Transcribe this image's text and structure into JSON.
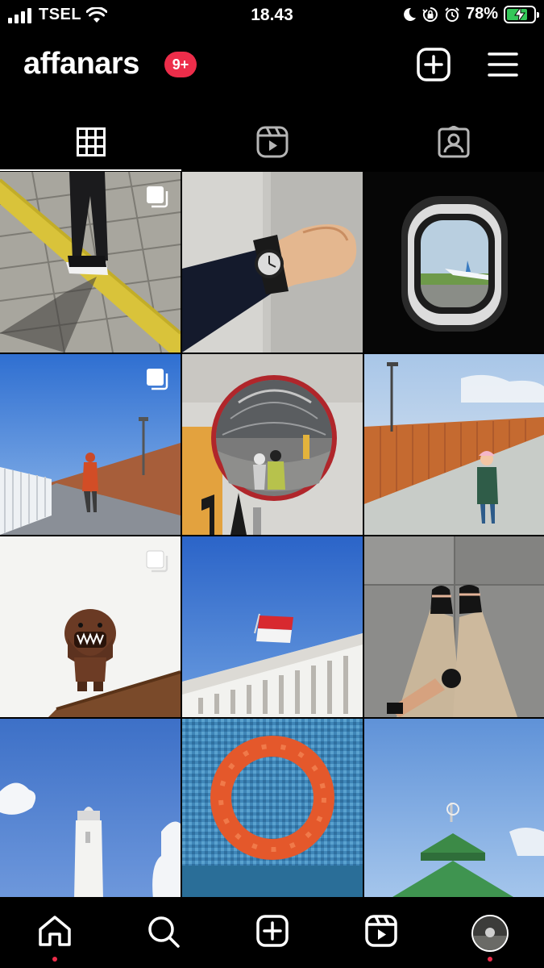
{
  "status_bar": {
    "carrier": "TSEL",
    "time": "18.43",
    "battery_percent": "78%",
    "battery_level": 0.78
  },
  "header": {
    "username": "affanars",
    "notification_count": "9+",
    "icons": [
      "add-post-icon",
      "menu-icon"
    ]
  },
  "profile_tabs": {
    "items": [
      {
        "name": "posts-grid-tab",
        "icon": "grid-icon",
        "active": true
      },
      {
        "name": "reels-tab",
        "icon": "reels-icon",
        "active": false
      },
      {
        "name": "tagged-tab",
        "icon": "tagged-person-icon",
        "active": false
      }
    ]
  },
  "posts": [
    {
      "subject": "feet on tactile paving",
      "multiple": true
    },
    {
      "subject": "wristwatch on wrist",
      "multiple": false
    },
    {
      "subject": "airplane window",
      "multiple": false
    },
    {
      "subject": "person on walkway under blue sky",
      "multiple": true
    },
    {
      "subject": "convex mirror selfie",
      "multiple": false
    },
    {
      "subject": "child walking on orange-fenced bridge",
      "multiple": false
    },
    {
      "subject": "toy figure on wooden rail",
      "multiple": true
    },
    {
      "subject": "red and white flag over building",
      "multiple": false
    },
    {
      "subject": "feet in sandals on marble",
      "multiple": false
    },
    {
      "subject": "white tower and clouds",
      "multiple": false
    },
    {
      "subject": "orange life ring on blue tiles",
      "multiple": false
    },
    {
      "subject": "green mosque roof",
      "multiple": false
    }
  ],
  "bottom_nav": {
    "items": [
      "home-icon",
      "search-icon",
      "create-icon",
      "reels-icon",
      "profile-avatar"
    ],
    "notification_dot_color": "#ed2d4a"
  },
  "colors": {
    "background": "#000000",
    "badge": "#ed2d4a",
    "battery": "#34c759"
  }
}
